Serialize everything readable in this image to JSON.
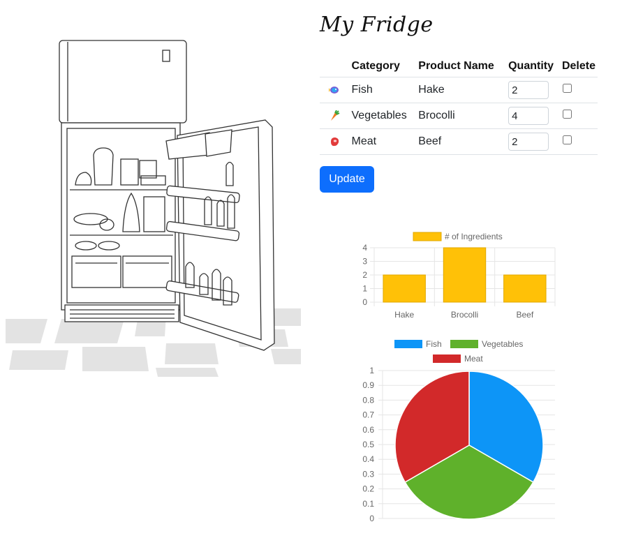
{
  "header": {
    "title": "My Fridge"
  },
  "table": {
    "headers": {
      "category": "Category",
      "product": "Product Name",
      "quantity": "Quantity",
      "delete": "Delete"
    },
    "rows": [
      {
        "icon": "fish-icon",
        "category": "Fish",
        "product": "Hake",
        "quantity": "2",
        "delete_checked": false
      },
      {
        "icon": "carrot-icon",
        "category": "Vegetables",
        "product": "Brocolli",
        "quantity": "4",
        "delete_checked": false
      },
      {
        "icon": "steak-icon",
        "category": "Meat",
        "product": "Beef",
        "quantity": "2",
        "delete_checked": false
      }
    ]
  },
  "actions": {
    "update_label": "Update"
  },
  "fridge_image": {
    "alt_icon": "open-fridge-illustration"
  },
  "colors": {
    "primary": "#0d6efd",
    "bar": "#ffc107",
    "fish": "#0d95f7",
    "vegetables": "#5fb12b",
    "meat": "#d2292a"
  },
  "chart_data": [
    {
      "type": "bar",
      "categories": [
        "Hake",
        "Brocolli",
        "Beef"
      ],
      "series": [
        {
          "name": "# of Ingredients",
          "values": [
            2,
            4,
            2
          ]
        }
      ],
      "ylim": [
        0,
        4
      ],
      "yticks": [
        "0",
        "1",
        "2",
        "3",
        "4"
      ],
      "legend": "top",
      "grid": true
    },
    {
      "type": "pie",
      "labels": [
        "Fish",
        "Vegetables",
        "Meat"
      ],
      "values": [
        1,
        1,
        1
      ],
      "yticks": [
        "0",
        "0.1",
        "0.2",
        "0.3",
        "0.4",
        "0.5",
        "0.6",
        "0.7",
        "0.8",
        "0.9",
        "1"
      ],
      "legend": "top",
      "grid": true
    }
  ]
}
